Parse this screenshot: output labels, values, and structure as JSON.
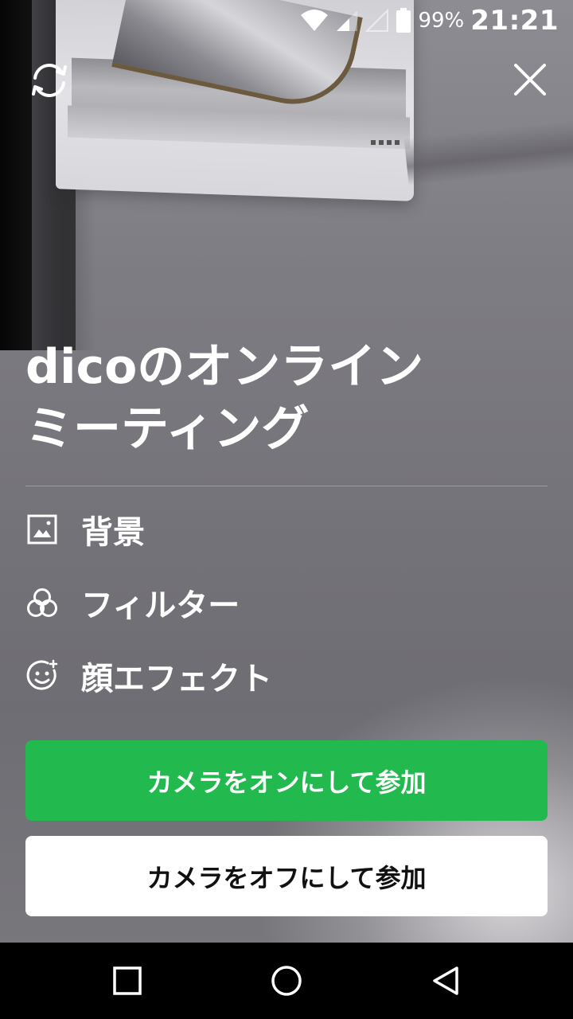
{
  "status_bar": {
    "battery_percent": "99%",
    "time": "21:21",
    "icons": [
      "wifi-icon",
      "signal-icon",
      "signal-empty-icon",
      "battery-icon"
    ]
  },
  "top_controls": {
    "flip_icon": "camera-flip-icon",
    "close_icon": "close-icon"
  },
  "meeting": {
    "title_line1": "dicoのオンライン",
    "title_line2": "ミーティング"
  },
  "options": [
    {
      "icon": "image-icon",
      "label": "背景"
    },
    {
      "icon": "filter-icon",
      "label": "フィルター"
    },
    {
      "icon": "face-effect-icon",
      "label": "顔エフェクト"
    }
  ],
  "buttons": {
    "join_camera_on": "カメラをオンにして参加",
    "join_camera_off": "カメラをオフにして参加"
  },
  "colors": {
    "primary_green": "#22b94e",
    "secondary_button": "#ffffff",
    "text_light": "#ffffff",
    "nav_bar": "#000000"
  },
  "nav_bar": {
    "icons": [
      "recent-apps-icon",
      "home-icon",
      "back-icon"
    ]
  }
}
